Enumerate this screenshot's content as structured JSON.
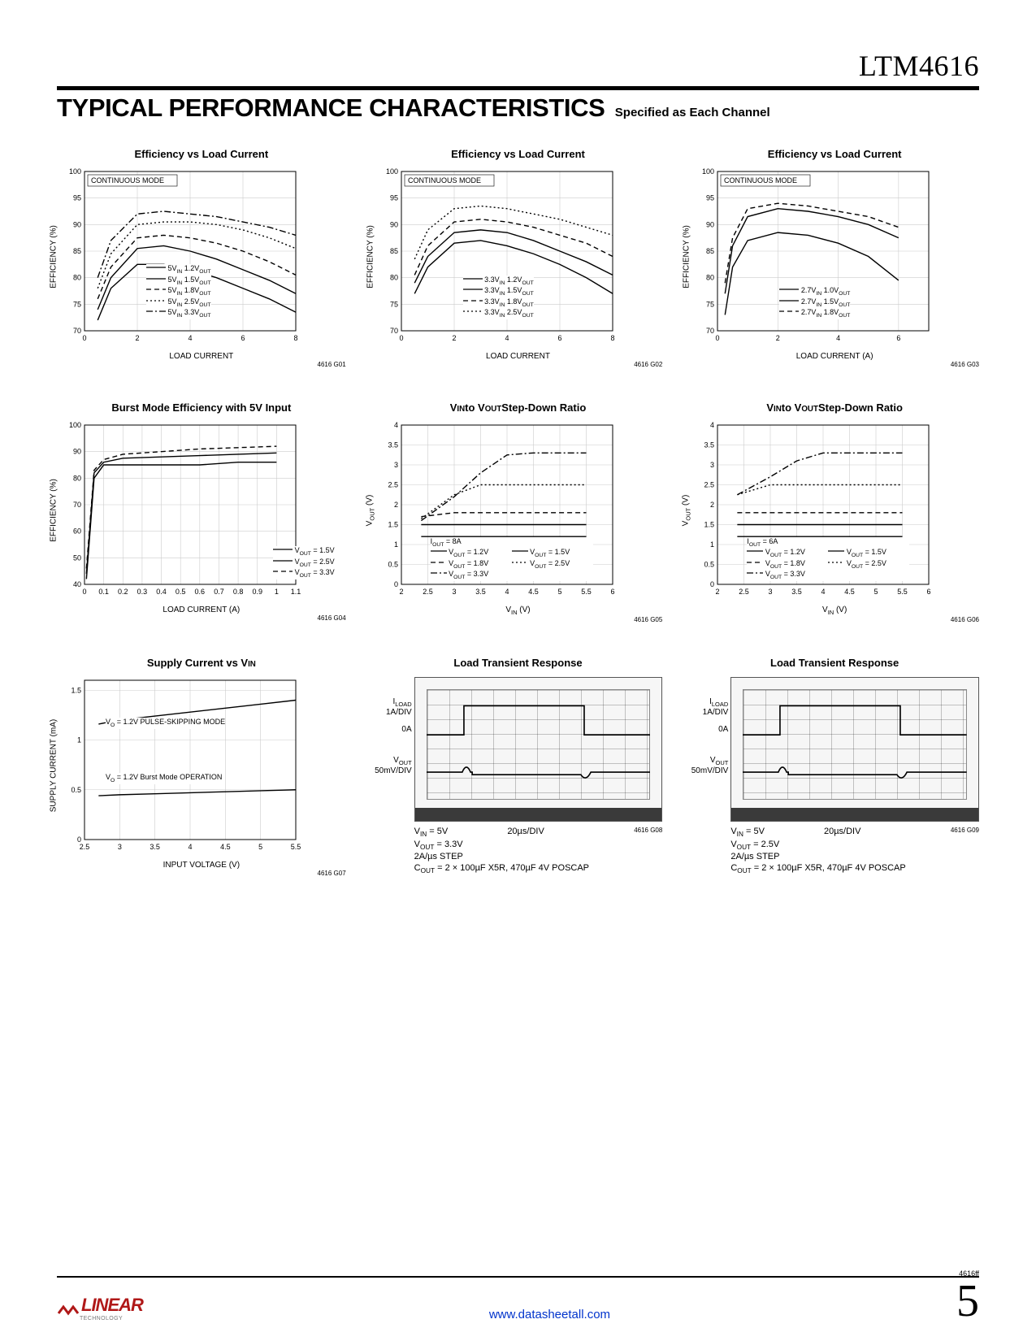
{
  "part_number": "LTM4616",
  "section_title": "TYPICAL PERFORMANCE CHARACTERISTICS",
  "section_sub": "Specified as Each Channel",
  "footer_code": "4616ff",
  "page_number": "5",
  "url": "www.datasheetall.com",
  "logo_text": "LINEAR",
  "logo_sub": "TECHNOLOGY",
  "chart_data": [
    {
      "title": "Efficiency vs Load Current",
      "type": "line",
      "xlabel": "LOAD CURRENT",
      "ylabel": "EFFICIENCY (%)",
      "xlim": [
        0,
        8
      ],
      "ylim": [
        70,
        100
      ],
      "x": [
        0.5,
        1,
        2,
        3,
        4,
        5,
        6,
        7,
        8
      ],
      "annotation": "CONTINUOUS MODE",
      "fig_code": "4616 G01",
      "series": [
        {
          "name": "5VIN 1.2VOUT",
          "values": [
            72,
            78,
            82.5,
            82.5,
            81.5,
            80,
            78,
            76,
            73.5
          ]
        },
        {
          "name": "5VIN 1.5VOUT",
          "values": [
            74,
            80,
            85.5,
            86,
            85,
            83.5,
            81.5,
            79.5,
            77
          ]
        },
        {
          "name": "5VIN 1.8VOUT",
          "values": [
            76,
            82,
            87.5,
            88,
            87.5,
            86.5,
            85,
            83,
            80.5
          ]
        },
        {
          "name": "5VIN 2.5VOUT",
          "values": [
            78,
            84.5,
            90,
            90.5,
            90.5,
            90,
            89,
            87.5,
            85.5
          ]
        },
        {
          "name": "5VIN 3.3VOUT",
          "values": [
            80,
            87,
            92,
            92.5,
            92,
            91.5,
            90.5,
            89.5,
            88
          ]
        }
      ]
    },
    {
      "title": "Efficiency vs Load Current",
      "type": "line",
      "xlabel": "LOAD CURRENT",
      "ylabel": "EFFICIENCY (%)",
      "xlim": [
        0,
        8
      ],
      "ylim": [
        70,
        100
      ],
      "x": [
        0.5,
        1,
        2,
        3,
        4,
        5,
        6,
        7,
        8
      ],
      "annotation": "CONTINUOUS MODE",
      "fig_code": "4616 G02",
      "series": [
        {
          "name": "3.3VIN 1.2VOUT",
          "values": [
            77,
            82,
            86.5,
            87,
            86,
            84.5,
            82.5,
            80,
            77
          ]
        },
        {
          "name": "3.3VIN 1.5VOUT",
          "values": [
            79,
            84,
            88.5,
            89,
            88.5,
            87,
            85,
            83,
            80.5
          ]
        },
        {
          "name": "3.3VIN 1.8VOUT",
          "values": [
            80.5,
            86,
            90.5,
            91,
            90.5,
            89.5,
            88,
            86.5,
            84
          ]
        },
        {
          "name": "3.3VIN 2.5VOUT",
          "values": [
            83.5,
            89,
            93,
            93.5,
            93,
            92,
            91,
            89.5,
            88
          ]
        }
      ]
    },
    {
      "title": "Efficiency vs Load Current",
      "type": "line",
      "xlabel": "LOAD CURRENT (A)",
      "ylabel": "EFFICIENCY (%)",
      "xlim": [
        0,
        7
      ],
      "ylim": [
        70,
        100
      ],
      "x": [
        0.25,
        0.5,
        1,
        2,
        3,
        4,
        5,
        6
      ],
      "annotation": "CONTINUOUS MODE",
      "fig_code": "4616 G03",
      "series": [
        {
          "name": "2.7VIN 1.0VOUT",
          "values": [
            73,
            82,
            87,
            88.5,
            88,
            86.5,
            84,
            79.5
          ]
        },
        {
          "name": "2.7VIN 1.5VOUT",
          "values": [
            77,
            86,
            91.5,
            93,
            92.5,
            91.5,
            90,
            87.5
          ]
        },
        {
          "name": "2.7VIN 1.8VOUT",
          "values": [
            79,
            87.5,
            93,
            94,
            93.5,
            92.5,
            91.5,
            89.5
          ]
        }
      ]
    },
    {
      "title": "Burst Mode Efficiency with 5V Input",
      "type": "line",
      "xlabel": "LOAD CURRENT (A)",
      "ylabel": "EFFICIENCY (%)",
      "xlim": [
        0,
        1.1
      ],
      "ylim": [
        40,
        100
      ],
      "x": [
        0.01,
        0.05,
        0.1,
        0.2,
        0.4,
        0.6,
        0.8,
        1.0
      ],
      "fig_code": "4616 G04",
      "series": [
        {
          "name": "VOUT = 1.5V",
          "values": [
            42,
            80,
            85,
            85,
            85,
            85,
            86,
            86
          ]
        },
        {
          "name": "VOUT = 2.5V",
          "values": [
            44,
            82,
            86,
            87.5,
            88,
            88.5,
            89,
            89.5
          ]
        },
        {
          "name": "VOUT = 3.3V",
          "values": [
            46,
            83,
            87,
            89,
            90,
            91,
            91.5,
            92
          ]
        }
      ]
    },
    {
      "title": "VIN to VOUT Step-Down Ratio",
      "type": "line",
      "xlabel": "VIN (V)",
      "ylabel": "VOUT (V)",
      "xlim": [
        2,
        6
      ],
      "ylim": [
        0,
        4.0
      ],
      "x": [
        2.375,
        3,
        3.5,
        4,
        4.5,
        5,
        5.5
      ],
      "annotation": "IOUT = 8A",
      "fig_code": "4616 G05",
      "series": [
        {
          "name": "VOUT = 1.2V",
          "values": [
            1.2,
            1.2,
            1.2,
            1.2,
            1.2,
            1.2,
            1.2
          ]
        },
        {
          "name": "VOUT = 1.5V",
          "values": [
            1.5,
            1.5,
            1.5,
            1.5,
            1.5,
            1.5,
            1.5
          ]
        },
        {
          "name": "VOUT = 1.8V",
          "values": [
            1.7,
            1.8,
            1.8,
            1.8,
            1.8,
            1.8,
            1.8
          ]
        },
        {
          "name": "VOUT = 2.5V",
          "values": [
            1.65,
            2.25,
            2.5,
            2.5,
            2.5,
            2.5,
            2.5
          ]
        },
        {
          "name": "VOUT = 3.3V",
          "values": [
            1.6,
            2.2,
            2.8,
            3.25,
            3.3,
            3.3,
            3.3
          ]
        }
      ]
    },
    {
      "title": "VIN to VOUT Step-Down Ratio",
      "type": "line",
      "xlabel": "VIN (V)",
      "ylabel": "VOUT (V)",
      "xlim": [
        2,
        6
      ],
      "ylim": [
        0,
        4.0
      ],
      "x": [
        2.375,
        3,
        3.5,
        4,
        4.5,
        5,
        5.5
      ],
      "annotation": "IOUT = 6A",
      "fig_code": "4616 G06",
      "series": [
        {
          "name": "VOUT = 1.2V",
          "values": [
            1.2,
            1.2,
            1.2,
            1.2,
            1.2,
            1.2,
            1.2
          ]
        },
        {
          "name": "VOUT = 1.5V",
          "values": [
            1.5,
            1.5,
            1.5,
            1.5,
            1.5,
            1.5,
            1.5
          ]
        },
        {
          "name": "VOUT = 1.8V",
          "values": [
            1.8,
            1.8,
            1.8,
            1.8,
            1.8,
            1.8,
            1.8
          ]
        },
        {
          "name": "VOUT = 2.5V",
          "values": [
            2.25,
            2.5,
            2.5,
            2.5,
            2.5,
            2.5,
            2.5
          ]
        },
        {
          "name": "VOUT = 3.3V",
          "values": [
            2.25,
            2.7,
            3.1,
            3.3,
            3.3,
            3.3,
            3.3
          ]
        }
      ]
    },
    {
      "title": "Supply Current vs VIN",
      "type": "line",
      "xlabel": "INPUT VOLTAGE (V)",
      "ylabel": "SUPPLY CURRENT (mA)",
      "xlim": [
        2.5,
        5.5
      ],
      "ylim": [
        0,
        1.6
      ],
      "x": [
        2.7,
        3,
        3.5,
        4,
        4.5,
        5,
        5.5
      ],
      "fig_code": "4616 G07",
      "series": [
        {
          "name": "VO = 1.2V PULSE-SKIPPING MODE",
          "values": [
            1.16,
            1.2,
            1.24,
            1.28,
            1.32,
            1.36,
            1.4
          ]
        },
        {
          "name": "VO = 1.2V Burst Mode OPERATION",
          "values": [
            0.44,
            0.45,
            0.46,
            0.47,
            0.48,
            0.49,
            0.5
          ]
        }
      ]
    },
    {
      "title": "Load Transient Response",
      "type": "scope",
      "fig_code": "4616 G08",
      "conditions": [
        "VIN = 5V",
        "VOUT = 3.3V",
        "2A/µs STEP",
        "COUT = 2 × 100µF X5R, 470µF 4V POSCAP"
      ],
      "timebase": "20µs/DIV",
      "traces": [
        {
          "name": "ILOAD",
          "scale": "1A/DIV",
          "ref": "0A"
        },
        {
          "name": "VOUT",
          "scale": "50mV/DIV"
        }
      ]
    },
    {
      "title": "Load Transient Response",
      "type": "scope",
      "fig_code": "4616 G09",
      "conditions": [
        "VIN = 5V",
        "VOUT = 2.5V",
        "2A/µs STEP",
        "COUT = 2 × 100µF X5R, 470µF 4V POSCAP"
      ],
      "timebase": "20µs/DIV",
      "traces": [
        {
          "name": "ILOAD",
          "scale": "1A/DIV",
          "ref": "0A"
        },
        {
          "name": "VOUT",
          "scale": "50mV/DIV"
        }
      ]
    }
  ]
}
